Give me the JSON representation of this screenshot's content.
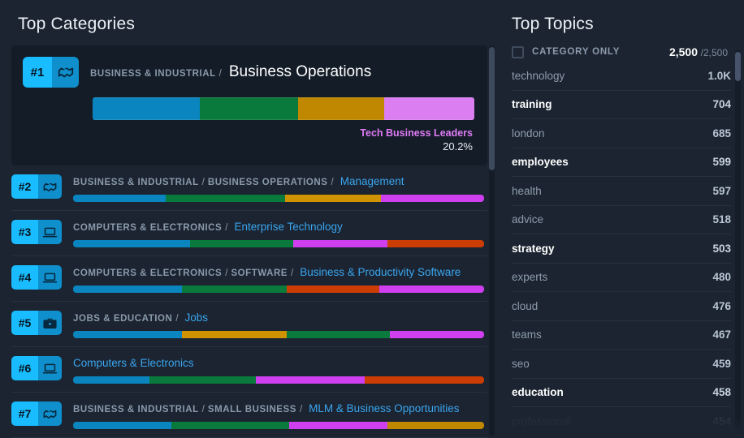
{
  "left": {
    "title": "Top Categories",
    "featured": {
      "rank": "#1",
      "icon": "handshake-icon",
      "crumbs": [
        "BUSINESS & INDUSTRIAL"
      ],
      "leaf": "Business Operations",
      "segments": [
        {
          "color": "#0a85bf",
          "pct": 28.0
        },
        {
          "color": "#0a7a3c",
          "pct": 25.8
        },
        {
          "color": "#bf8800",
          "pct": 22.5
        },
        {
          "color": "#da7ef2",
          "pct": 23.7
        }
      ],
      "highlight_name": "Tech Business Leaders",
      "highlight_pct": "20.2%"
    },
    "rows": [
      {
        "rank": "#2",
        "icon": "handshake-icon",
        "crumbs": [
          "BUSINESS & INDUSTRIAL",
          "BUSINESS OPERATIONS"
        ],
        "leaf": "Management",
        "segments": [
          {
            "color": "#0a85bf",
            "pct": 22.5
          },
          {
            "color": "#0a7a3c",
            "pct": 29.0
          },
          {
            "color": "#cf9200",
            "pct": 23.5
          },
          {
            "color": "#cf3ff0",
            "pct": 25.0
          }
        ]
      },
      {
        "rank": "#3",
        "icon": "laptop-icon",
        "crumbs": [
          "COMPUTERS & ELECTRONICS"
        ],
        "leaf": "Enterprise Technology",
        "segments": [
          {
            "color": "#0a85bf",
            "pct": 28.5
          },
          {
            "color": "#0a7a3c",
            "pct": 25.0
          },
          {
            "color": "#cf3ff0",
            "pct": 23.0
          },
          {
            "color": "#cc3d05",
            "pct": 23.5
          }
        ]
      },
      {
        "rank": "#4",
        "icon": "laptop-icon",
        "crumbs": [
          "COMPUTERS & ELECTRONICS",
          "SOFTWARE"
        ],
        "leaf": "Business & Productivity Software",
        "segments": [
          {
            "color": "#0a85bf",
            "pct": 26.5
          },
          {
            "color": "#0a7a3c",
            "pct": 25.5
          },
          {
            "color": "#cc3d05",
            "pct": 22.5
          },
          {
            "color": "#cf3ff0",
            "pct": 25.5
          }
        ]
      },
      {
        "rank": "#5",
        "icon": "briefcase-icon",
        "crumbs": [
          "JOBS & EDUCATION"
        ],
        "leaf": "Jobs",
        "segments": [
          {
            "color": "#0a85bf",
            "pct": 26.5
          },
          {
            "color": "#cf9200",
            "pct": 25.5
          },
          {
            "color": "#0a7a3c",
            "pct": 25.0
          },
          {
            "color": "#cf3ff0",
            "pct": 23.0
          }
        ]
      },
      {
        "rank": "#6",
        "icon": "laptop-icon",
        "crumbs": [],
        "leaf": "Computers & Electronics",
        "segments": [
          {
            "color": "#0a85bf",
            "pct": 18.5
          },
          {
            "color": "#0a7a3c",
            "pct": 26.0
          },
          {
            "color": "#cf3ff0",
            "pct": 26.5
          },
          {
            "color": "#cc3d05",
            "pct": 29.0
          }
        ]
      },
      {
        "rank": "#7",
        "icon": "handshake-icon",
        "crumbs": [
          "BUSINESS & INDUSTRIAL",
          "SMALL BUSINESS"
        ],
        "leaf": "MLM & Business Opportunities",
        "segments": [
          {
            "color": "#0a85bf",
            "pct": 24.0
          },
          {
            "color": "#0a7a3c",
            "pct": 28.5
          },
          {
            "color": "#cf3ff0",
            "pct": 24.0
          },
          {
            "color": "#bf8800",
            "pct": 23.5
          }
        ]
      }
    ]
  },
  "right": {
    "title": "Top Topics",
    "category_only_label": "CATEGORY ONLY",
    "category_only_checked": false,
    "count_shown": "2,500",
    "count_total": "/2,500",
    "topics": [
      {
        "name": "technology",
        "value": "1.0K",
        "bold": false
      },
      {
        "name": "training",
        "value": "704",
        "bold": true
      },
      {
        "name": "london",
        "value": "685",
        "bold": false
      },
      {
        "name": "employees",
        "value": "599",
        "bold": true
      },
      {
        "name": "health",
        "value": "597",
        "bold": false
      },
      {
        "name": "advice",
        "value": "518",
        "bold": false
      },
      {
        "name": "strategy",
        "value": "503",
        "bold": true
      },
      {
        "name": "experts",
        "value": "480",
        "bold": false
      },
      {
        "name": "cloud",
        "value": "476",
        "bold": false
      },
      {
        "name": "teams",
        "value": "467",
        "bold": false
      },
      {
        "name": "seo",
        "value": "459",
        "bold": false
      },
      {
        "name": "education",
        "value": "458",
        "bold": true
      },
      {
        "name": "professional",
        "value": "454",
        "bold": false
      }
    ]
  },
  "colors": {
    "background": "#1b2430",
    "panel": "#131c27",
    "accent_cyan": "#18bcff",
    "link_blue": "#3aa5f0",
    "magenta": "#df7bf5"
  }
}
